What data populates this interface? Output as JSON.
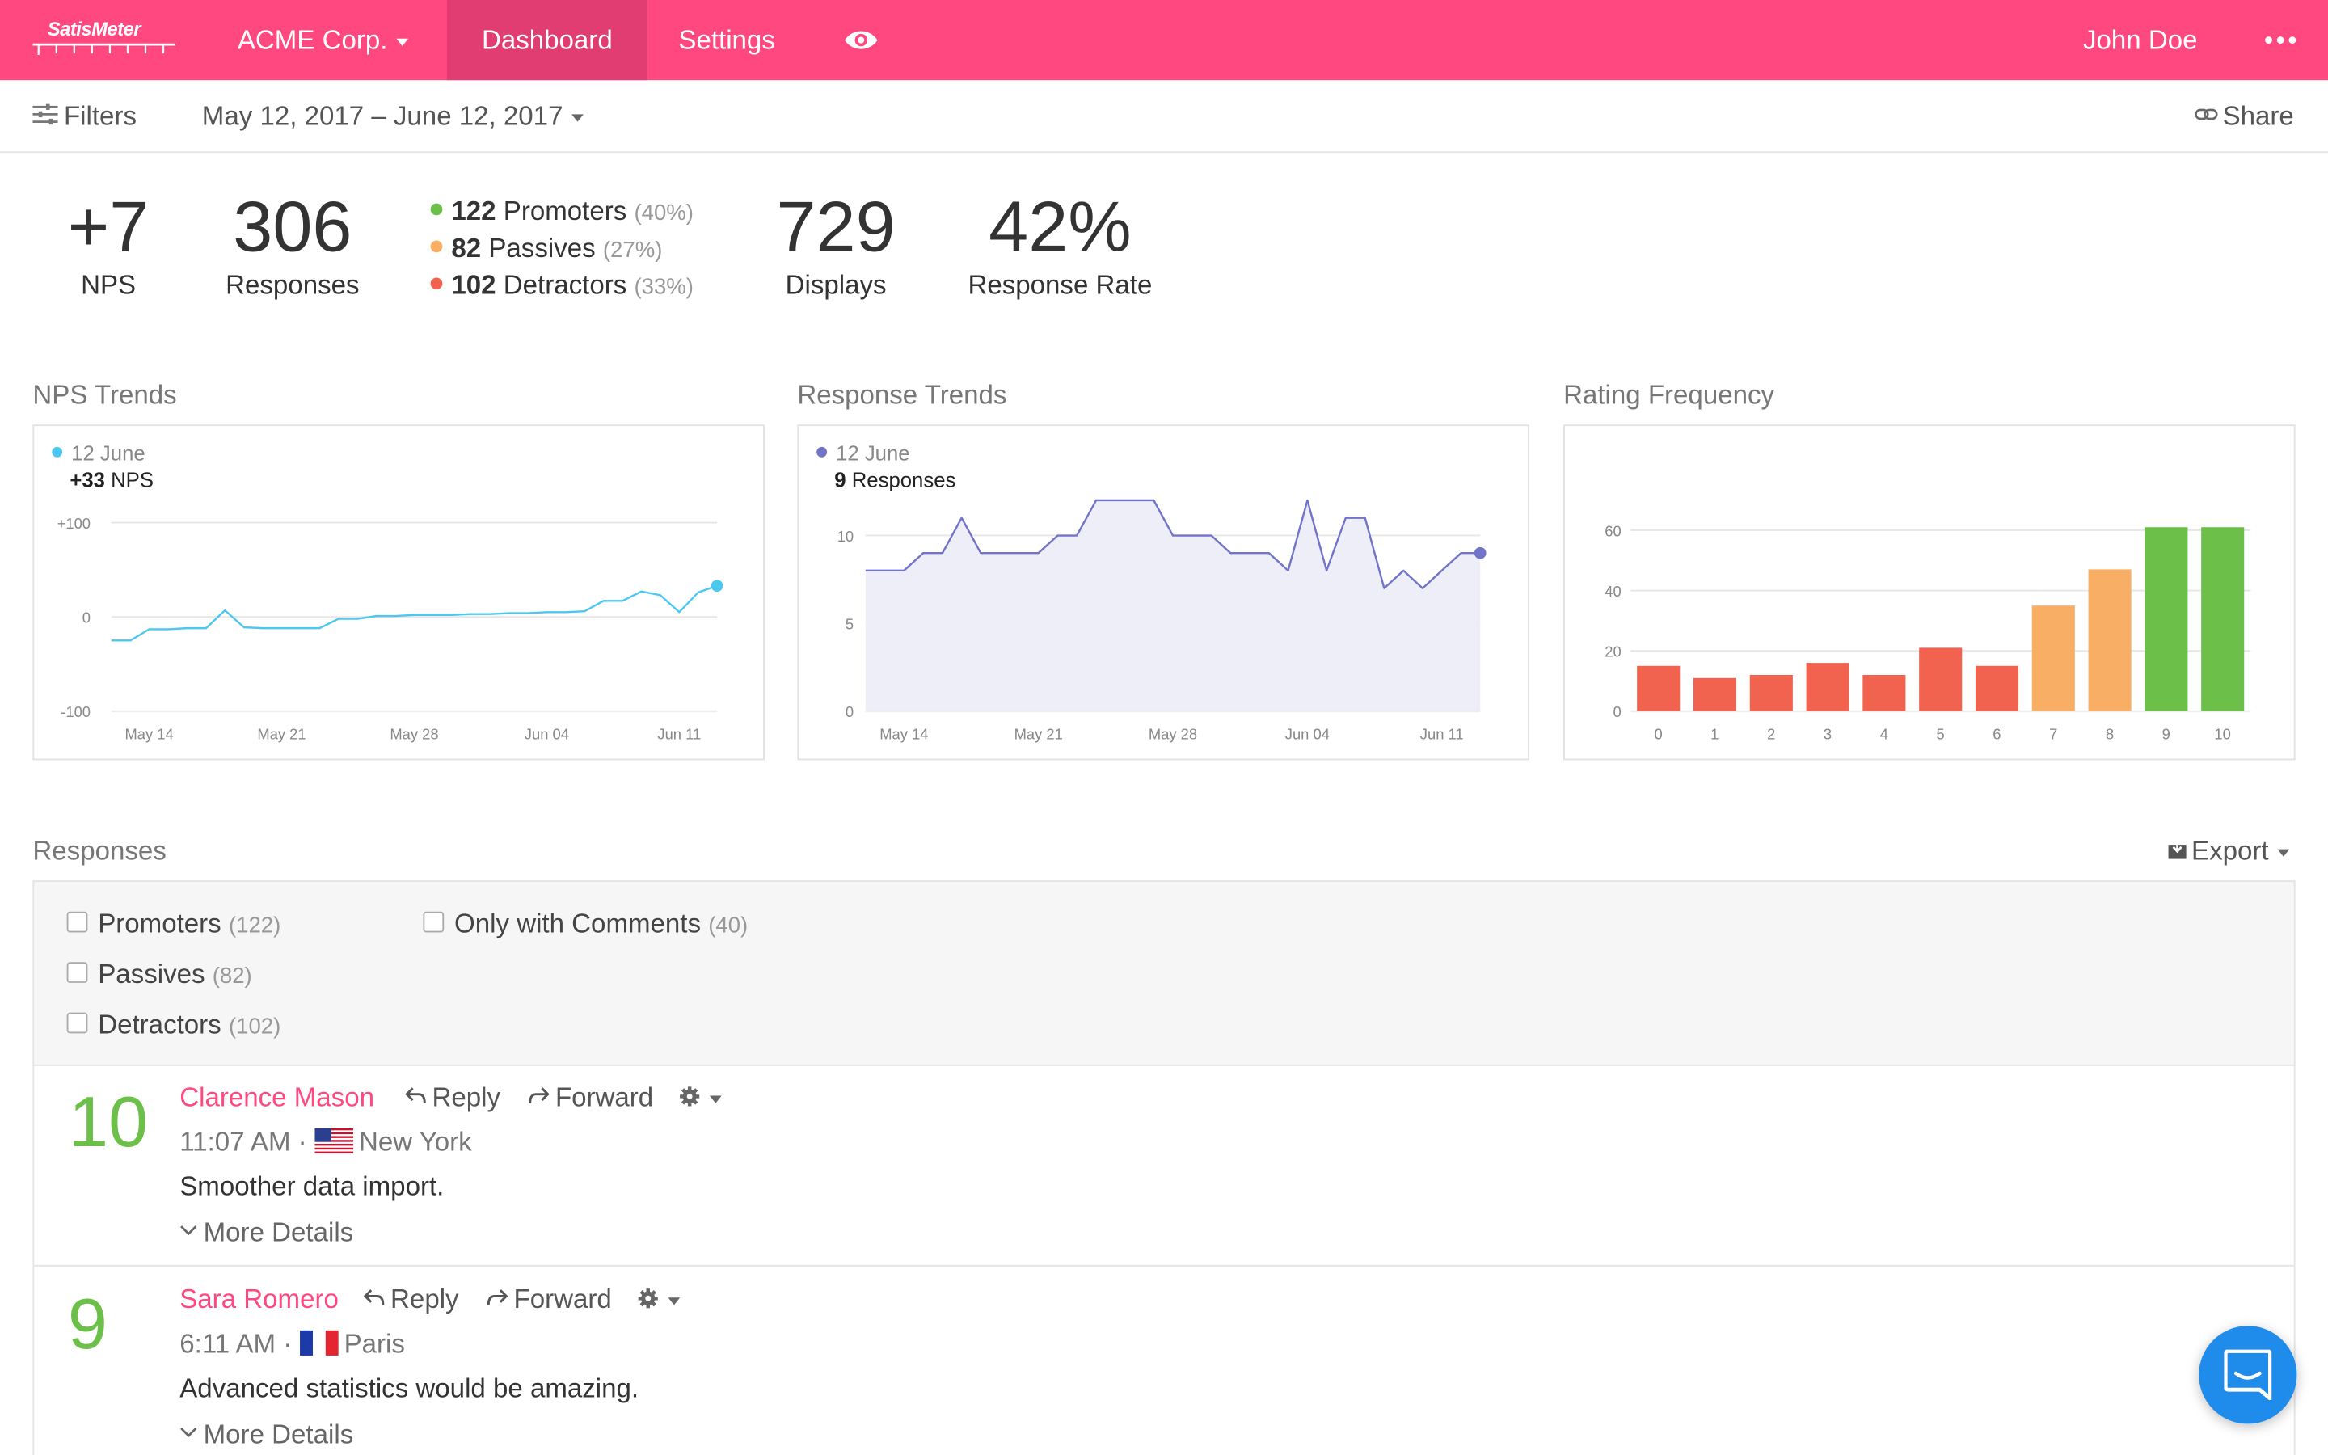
{
  "brand": {
    "name": "SatisMeter"
  },
  "topbar": {
    "account": "ACME Corp.",
    "nav": [
      "Dashboard",
      "Settings"
    ],
    "user": "John Doe"
  },
  "filterbar": {
    "filters_label": "Filters",
    "date_range": "May 12, 2017 – June 12, 2017",
    "share_label": "Share"
  },
  "stats": {
    "nps": {
      "value": "+7",
      "label": "NPS"
    },
    "responses": {
      "value": "306",
      "label": "Responses"
    },
    "promoters": {
      "count": "122",
      "label": "Promoters",
      "pct": "(40%)"
    },
    "passives": {
      "count": "82",
      "label": "Passives",
      "pct": "(27%)"
    },
    "detractors": {
      "count": "102",
      "label": "Detractors",
      "pct": "(33%)"
    },
    "displays": {
      "value": "729",
      "label": "Displays"
    },
    "rate": {
      "value": "42%",
      "label": "Response Rate"
    }
  },
  "colors": {
    "brand": "#ff4880",
    "promoter": "#6cc04a",
    "passive": "#f9ae66",
    "detractor": "#f2634f",
    "nps_line": "#4cc8f0",
    "resp_line": "#7174c8"
  },
  "chart_data": [
    {
      "type": "line",
      "title": "NPS Trends",
      "x_ticks": [
        "May 14",
        "May 21",
        "May 28",
        "Jun 04",
        "Jun 11"
      ],
      "y_ticks": [
        "+100",
        "0",
        "-100"
      ],
      "ylim": [
        -100,
        100
      ],
      "tooltip": {
        "date": "12 June",
        "value": "+33",
        "unit": "NPS"
      },
      "points": [
        [
          0,
          -25
        ],
        [
          1,
          -25
        ],
        [
          2,
          -13
        ],
        [
          3,
          -13
        ],
        [
          4,
          -12
        ],
        [
          5,
          -12
        ],
        [
          6,
          7
        ],
        [
          7,
          -11
        ],
        [
          8,
          -12
        ],
        [
          9,
          -12
        ],
        [
          10,
          -12
        ],
        [
          11,
          -12
        ],
        [
          12,
          -2
        ],
        [
          13,
          -2
        ],
        [
          14,
          1
        ],
        [
          15,
          1
        ],
        [
          16,
          2
        ],
        [
          17,
          2
        ],
        [
          18,
          2
        ],
        [
          19,
          3
        ],
        [
          20,
          3
        ],
        [
          21,
          4
        ],
        [
          22,
          4
        ],
        [
          23,
          5
        ],
        [
          24,
          5
        ],
        [
          25,
          6
        ],
        [
          26,
          17
        ],
        [
          27,
          17
        ],
        [
          28,
          27
        ],
        [
          29,
          23
        ],
        [
          30,
          5
        ],
        [
          31,
          26
        ],
        [
          32,
          33
        ]
      ]
    },
    {
      "type": "area",
      "title": "Response Trends",
      "x_ticks": [
        "May 14",
        "May 21",
        "May 28",
        "Jun 04",
        "Jun 11"
      ],
      "y_ticks": [
        "10",
        "5",
        "0"
      ],
      "ylim": [
        0,
        12
      ],
      "tooltip": {
        "date": "12 June",
        "value": "9",
        "unit": "Responses"
      },
      "points": [
        [
          0,
          8
        ],
        [
          1,
          8
        ],
        [
          2,
          8
        ],
        [
          3,
          9
        ],
        [
          4,
          9
        ],
        [
          5,
          11
        ],
        [
          6,
          9
        ],
        [
          7,
          9
        ],
        [
          8,
          9
        ],
        [
          9,
          9
        ],
        [
          10,
          10
        ],
        [
          11,
          10
        ],
        [
          12,
          12
        ],
        [
          13,
          12
        ],
        [
          14,
          12
        ],
        [
          15,
          12
        ],
        [
          16,
          10
        ],
        [
          17,
          10
        ],
        [
          18,
          10
        ],
        [
          19,
          9
        ],
        [
          20,
          9
        ],
        [
          21,
          9
        ],
        [
          22,
          8
        ],
        [
          23,
          12
        ],
        [
          24,
          8
        ],
        [
          25,
          11
        ],
        [
          26,
          11
        ],
        [
          27,
          7
        ],
        [
          28,
          8
        ],
        [
          29,
          7
        ],
        [
          30,
          8
        ],
        [
          31,
          9
        ],
        [
          32,
          9
        ]
      ]
    },
    {
      "type": "bar",
      "title": "Rating Frequency",
      "categories": [
        "0",
        "1",
        "2",
        "3",
        "4",
        "5",
        "6",
        "7",
        "8",
        "9",
        "10"
      ],
      "values": [
        15,
        11,
        12,
        16,
        12,
        21,
        15,
        35,
        47,
        61,
        61
      ],
      "y_ticks": [
        "60",
        "40",
        "20",
        "0"
      ],
      "ylim": [
        0,
        64
      ]
    }
  ],
  "responses": {
    "title": "Responses",
    "export_label": "Export",
    "filters": {
      "promoters": {
        "label": "Promoters",
        "count": "(122)"
      },
      "passives": {
        "label": "Passives",
        "count": "(82)"
      },
      "detractors": {
        "label": "Detractors",
        "count": "(102)"
      },
      "comments": {
        "label": "Only with Comments",
        "count": "(40)"
      }
    },
    "reply_label": "Reply",
    "forward_label": "Forward",
    "more_label": "More Details",
    "items": [
      {
        "score": "10",
        "name": "Clarence Mason",
        "time": "11:07 AM",
        "city": "New York",
        "comment": "Smoother data import."
      },
      {
        "score": "9",
        "name": "Sara Romero",
        "time": "6:11 AM",
        "city": "Paris",
        "comment": "Advanced statistics would be amazing."
      }
    ]
  }
}
